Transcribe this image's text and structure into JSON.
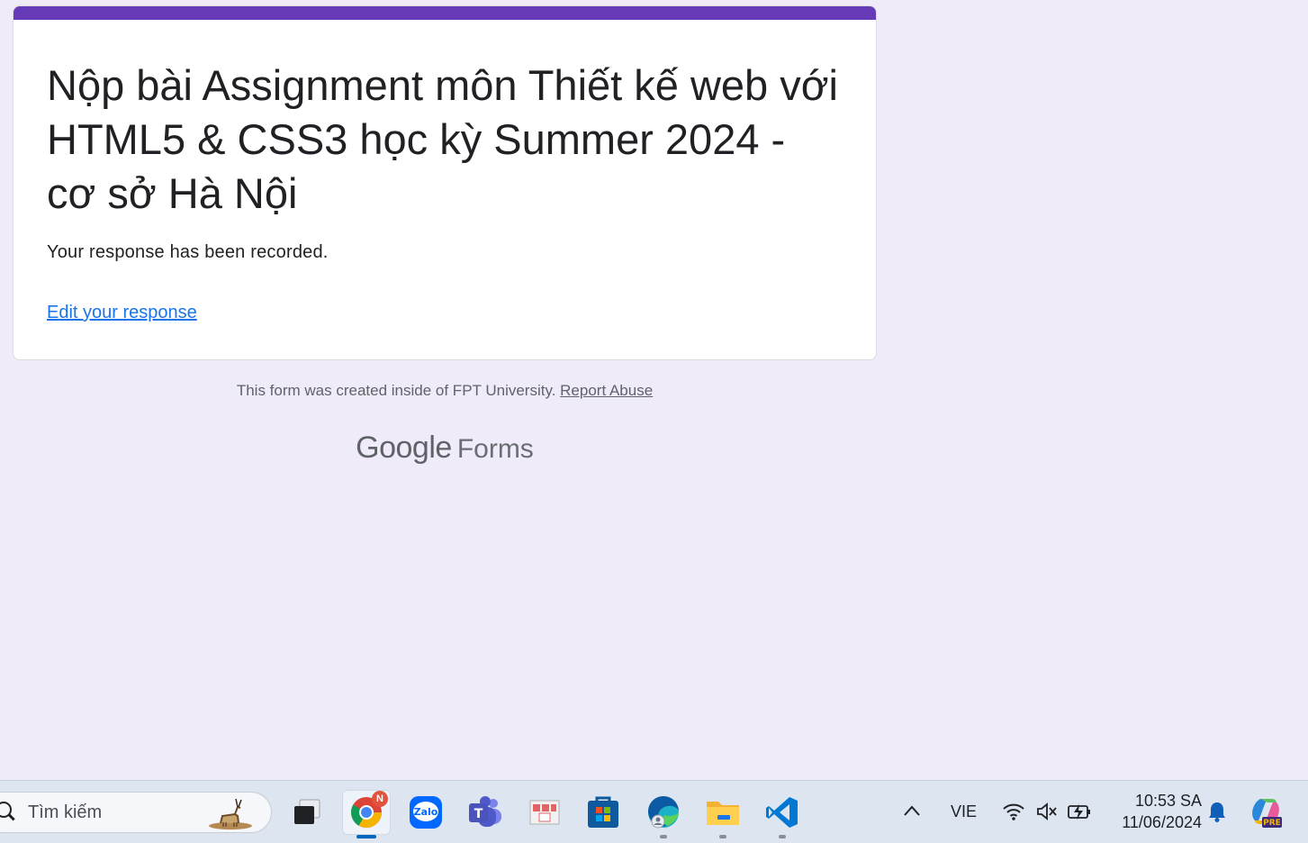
{
  "form": {
    "title": "Nộp bài Assignment môn Thiết kế web với HTML5 & CSS3 học kỳ Summer 2024 - cơ sở Hà Nội",
    "confirmation": "Your response has been recorded.",
    "edit_link": "Edit your response",
    "accent_color": "#673ab7"
  },
  "footer": {
    "note": "This form was created inside of FPT University.",
    "report_link": "Report Abuse",
    "logo_google": "Google",
    "logo_forms": "Forms"
  },
  "taskbar": {
    "search_placeholder": "Tìm kiếm",
    "apps": [
      {
        "name": "task-view",
        "icon": "task-view-icon"
      },
      {
        "name": "chrome",
        "icon": "chrome-icon",
        "badge": "N",
        "active": true
      },
      {
        "name": "zalo",
        "icon": "zalo-icon",
        "label": "Zalo"
      },
      {
        "name": "teams",
        "icon": "teams-icon",
        "label": "T"
      },
      {
        "name": "app",
        "icon": "app-icon"
      },
      {
        "name": "microsoft-store",
        "icon": "store-icon"
      },
      {
        "name": "edge",
        "icon": "edge-icon"
      },
      {
        "name": "file-explorer",
        "icon": "folder-icon"
      },
      {
        "name": "vscode",
        "icon": "vscode-icon"
      }
    ],
    "tray": {
      "language": "VIE",
      "time": "10:53 SA",
      "date": "11/06/2024",
      "copilot_label": "PRE"
    }
  }
}
